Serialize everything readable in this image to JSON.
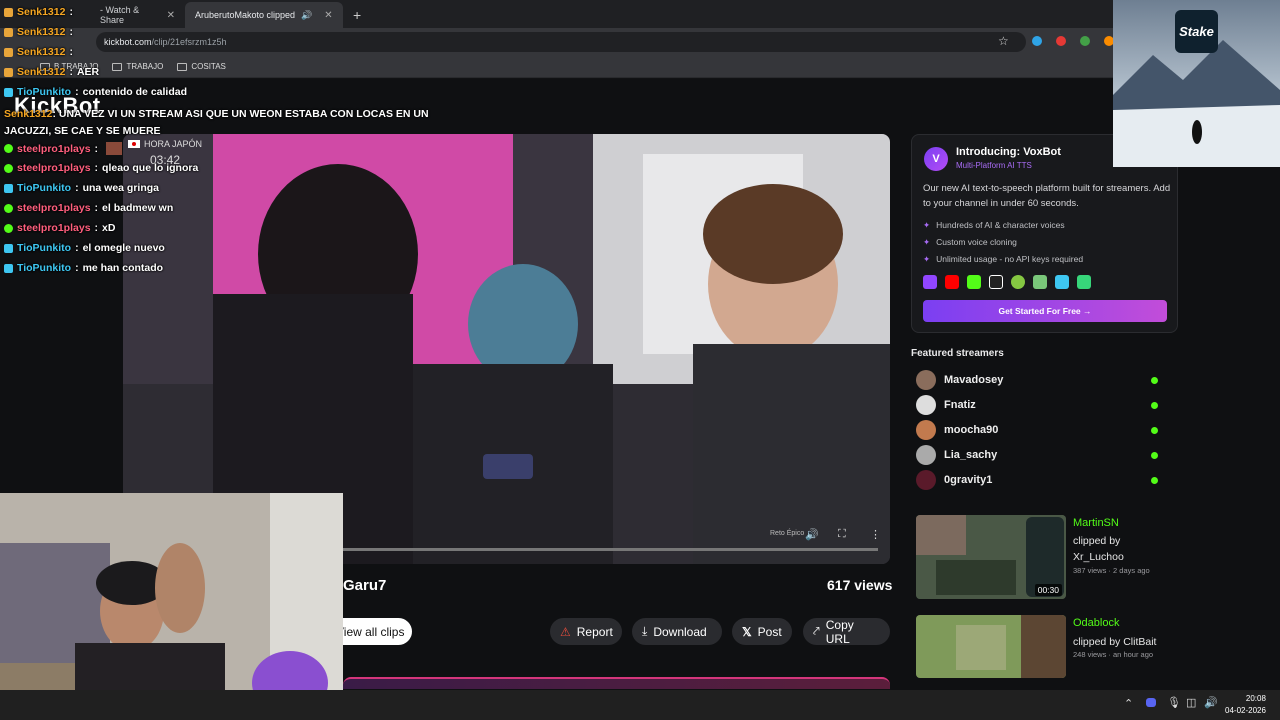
{
  "browser": {
    "tabs": [
      {
        "label": "- Watch & Share",
        "active": false
      },
      {
        "label": "AruberutoMakoto clipped",
        "active": true
      }
    ],
    "url_domain": "kickbot.com",
    "url_path": "/clip/21efsrzm1z5h",
    "bookmarks": [
      "B.TRABAJO",
      "TRABAJO",
      "COSITAS"
    ]
  },
  "site": {
    "logo": "KickBot",
    "streamer": "Garu7",
    "views": "617 views",
    "video_overlay": {
      "flag_text": "HORA JAPÓN",
      "time": "03:42",
      "credit": "Reto Épico"
    },
    "progress_pct": 0,
    "buttons": {
      "view_all": "View all clips",
      "report": "Report",
      "download": "Download",
      "post": "Post",
      "copy_url": "Copy URL"
    }
  },
  "voxbot": {
    "title": "Introducing: VoxBot",
    "subtitle": "Multi-Platform AI TTS",
    "description": "Our new AI text-to-speech platform built for streamers. Add to your channel in under 60 seconds.",
    "features": [
      "Hundreds of AI & character voices",
      "Custom voice cloning",
      "Unlimited usage - no API keys required"
    ],
    "cta": "Get Started For Free →"
  },
  "featured": {
    "title": "Featured streamers",
    "streamers": [
      "Mavadosey",
      "Fnatiz",
      "moocha90",
      "Lia_sachy",
      "0gravity1"
    ]
  },
  "clips": [
    {
      "streamer": "MartinSN",
      "clipped_by": "clipped by",
      "clipper": "Xr_Luchoo",
      "meta": "387 views · 2 days ago",
      "duration": "00:30"
    },
    {
      "streamer": "Odablock",
      "clipped_by": "clipped by ClitBait",
      "clipper": "",
      "meta": "248 views · an hour ago",
      "duration": ""
    }
  ],
  "stake": {
    "logo": "Stake"
  },
  "chat": [
    {
      "user": "Senk1312",
      "text": "",
      "color": "#f5a623"
    },
    {
      "user": "Senk1312",
      "text": "",
      "color": "#f5a623"
    },
    {
      "user": "Senk1312",
      "text": "",
      "color": "#f5a623"
    },
    {
      "user": "Senk1312",
      "text": "AER",
      "color": "#f5a623"
    },
    {
      "user": "TioPunkito",
      "text": "contenido de calidad",
      "color": "#3ec7f2"
    },
    {
      "user": "steelpro1plays",
      "text": "",
      "color": "#ff5f7e"
    },
    {
      "user": "steelpro1plays",
      "text": "qleao que lo ignora",
      "color": "#ff5f7e"
    },
    {
      "user": "TioPunkito",
      "text": "una wea gringa",
      "color": "#3ec7f2"
    },
    {
      "user": "steelpro1plays",
      "text": "el badmew wn",
      "color": "#ff5f7e"
    },
    {
      "user": "steelpro1plays",
      "text": "xD",
      "color": "#ff5f7e"
    },
    {
      "user": "TioPunkito",
      "text": "el omegle nuevo",
      "color": "#3ec7f2"
    },
    {
      "user": "TioPunkito",
      "text": "me han contado",
      "color": "#3ec7f2"
    }
  ],
  "chat_long": {
    "user": "Senk1312",
    "text": "UNA VEZ VI UN STREAM ASI QUE UN WEON ESTABA CON LOCAS EN UN JACUZZI, SE CAE Y SE MUERE"
  },
  "taskbar": {
    "time": "20:08",
    "date": "04-02-2026"
  },
  "colors": {
    "kick_green": "#53fc18",
    "vox_purple": "#7b3ff2",
    "accent_pink": "#d4367b"
  }
}
